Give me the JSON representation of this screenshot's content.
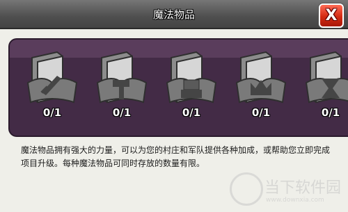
{
  "window": {
    "title": "魔法物品",
    "close_label": "X"
  },
  "items": [
    {
      "icon": "sword-book-icon",
      "count": "0/1"
    },
    {
      "icon": "hammer-book-icon",
      "count": "0/1"
    },
    {
      "icon": "stump-book-icon",
      "count": "0/1"
    },
    {
      "icon": "crown-book-icon",
      "count": "0/1"
    },
    {
      "icon": "hourglass-book-icon",
      "count": "0/1"
    }
  ],
  "description": "魔法物品拥有强大的力量，可以为您的村庄和军队提供各种加成，或帮助您立即完成项目升级。每种魔法物品可同时存放的数量有限。",
  "watermark": {
    "name": "当下软件园",
    "url": "www.downxia.com"
  }
}
